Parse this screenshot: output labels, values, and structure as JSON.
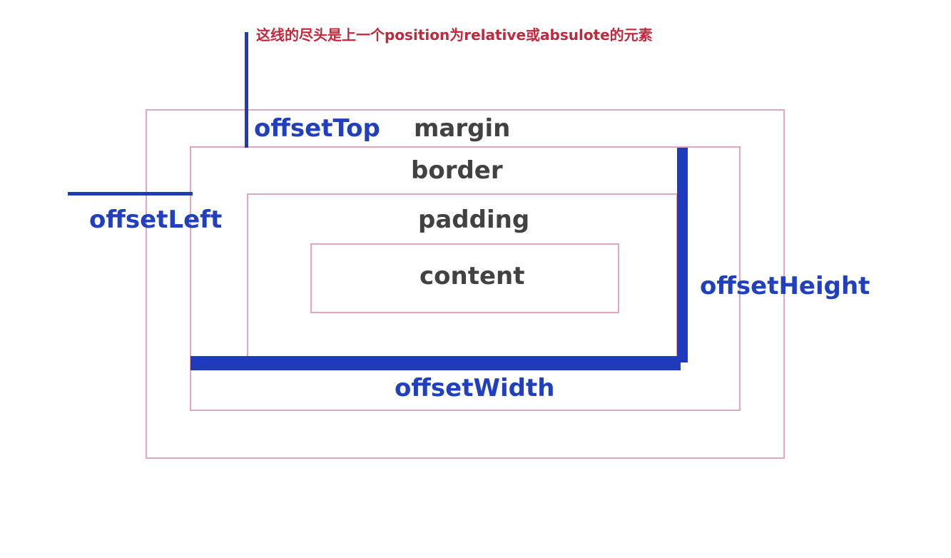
{
  "note": "这线的尽头是上一个position为relative或absulote的元素",
  "layers": {
    "margin": "margin",
    "border": "border",
    "padding": "padding",
    "content": "content"
  },
  "offsets": {
    "top": "offsetTop",
    "left": "offsetLeft",
    "height": "offsetHeight",
    "width": "offsetWidth"
  },
  "colors": {
    "box_outline": "#e2a6c4",
    "offset_lines": "#1f3bbd",
    "offset_labels": "#2040bf",
    "layer_labels": "#424242",
    "note_text": "#c0283c"
  }
}
